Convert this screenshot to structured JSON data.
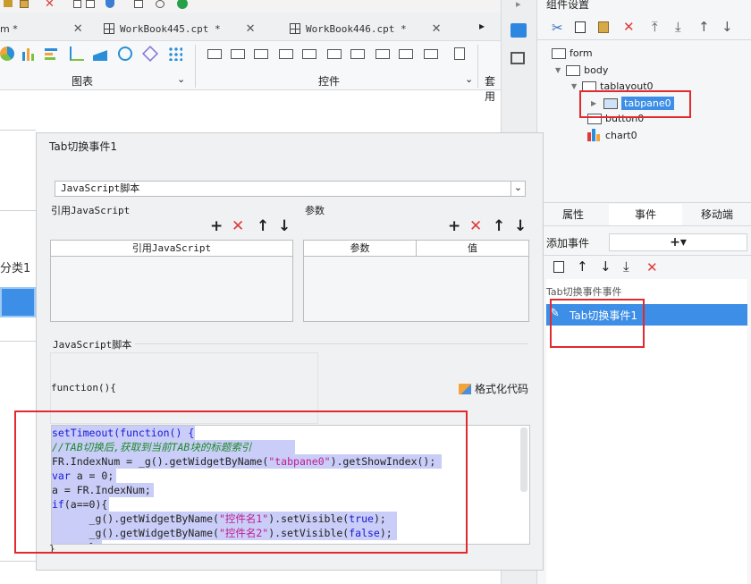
{
  "toolbar": {
    "tabs": [
      {
        "label": "m *"
      },
      {
        "label": "WorkBook445.cpt *"
      },
      {
        "label": "WorkBook446.cpt *"
      }
    ],
    "ribbon_groups": {
      "charts": "图表",
      "controls": "控件",
      "overflow": "套用"
    }
  },
  "left_fragments": {
    "label_classify": "分类1"
  },
  "component_settings": {
    "title": "组件设置",
    "tree": {
      "form": "form",
      "body": "body",
      "tablayout": "tablayout0",
      "tabpane": "tabpane0",
      "button": "button0",
      "chart": "chart0"
    },
    "tabs": {
      "properties": "属性",
      "events": "事件",
      "mobile": "移动端"
    },
    "add_event_label": "添加事件",
    "add_event_button": "+▾",
    "event_group": "Tab切换事件事件",
    "event_item": "Tab切换事件1"
  },
  "dialog": {
    "title": "Tab切换事件1",
    "script_type": "JavaScript脚本",
    "ref_js_label": "引用JavaScript",
    "params_label": "参数",
    "ref_js_column": "引用JavaScript",
    "param_columns": [
      "参数",
      "值"
    ],
    "script_section_label": "JavaScript脚本",
    "function_signature": "function(){",
    "format_code_button": "格式化代码",
    "closing_brace": "}",
    "code_lines": [
      "setTimeout(function() {",
      "//TAB切换后,获取到当前TAB块的标题索引",
      "FR.IndexNum = _g().getWidgetByName(\"tabpane0\").getShowIndex();",
      "var a = 0;",
      "a = FR.IndexNum;",
      "if(a==0){",
      "      _g().getWidgetByName(\"控件名1\").setVisible(true);",
      "      _g().getWidgetByName(\"控件名2\").setVisible(false);",
      "      }"
    ]
  },
  "colors": {
    "highlight": "#e2292f",
    "selection": "#3d8ee6",
    "code_bg": "#c9cdf7"
  }
}
